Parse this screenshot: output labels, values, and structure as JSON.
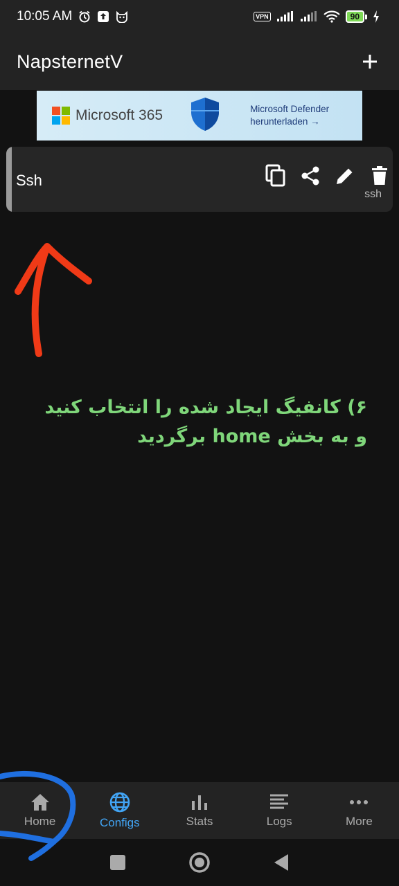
{
  "status_bar": {
    "time": "10:05 AM",
    "vpn_label": "VPN",
    "battery_level": "90",
    "icons": [
      "alarm-icon",
      "upload-icon",
      "cat-icon",
      "vpn-icon",
      "signal-icon",
      "signal-icon",
      "wifi-icon",
      "battery-icon",
      "charging-icon"
    ]
  },
  "app_bar": {
    "title": "NapsternetV",
    "add_icon": "plus-icon"
  },
  "ad": {
    "brand": "Microsoft 365",
    "cta_line1": "Microsoft Defender",
    "cta_line2": "herunterladen →"
  },
  "config": {
    "name": "Ssh",
    "type": "ssh",
    "actions": [
      "copy-icon",
      "share-icon",
      "edit-icon",
      "delete-icon"
    ]
  },
  "annotation": {
    "text": "۶) کانفیگ ایجاد شده را انتخاب کنید و به بخش home برگردید"
  },
  "bottom_nav": {
    "items": [
      {
        "label": "Home",
        "icon": "home-icon"
      },
      {
        "label": "Configs",
        "icon": "globe-icon"
      },
      {
        "label": "Stats",
        "icon": "bar-chart-icon"
      },
      {
        "label": "Logs",
        "icon": "list-icon"
      },
      {
        "label": "More",
        "icon": "more-icon"
      }
    ],
    "active": "Configs"
  },
  "colors": {
    "background": "#121212",
    "bar": "#232323",
    "card": "#262626",
    "accent": "#42a5f5",
    "annotation_text": "#7fd67a",
    "annotation_arrow": "#f03a17",
    "annotation_circle": "#1f6fe0"
  }
}
